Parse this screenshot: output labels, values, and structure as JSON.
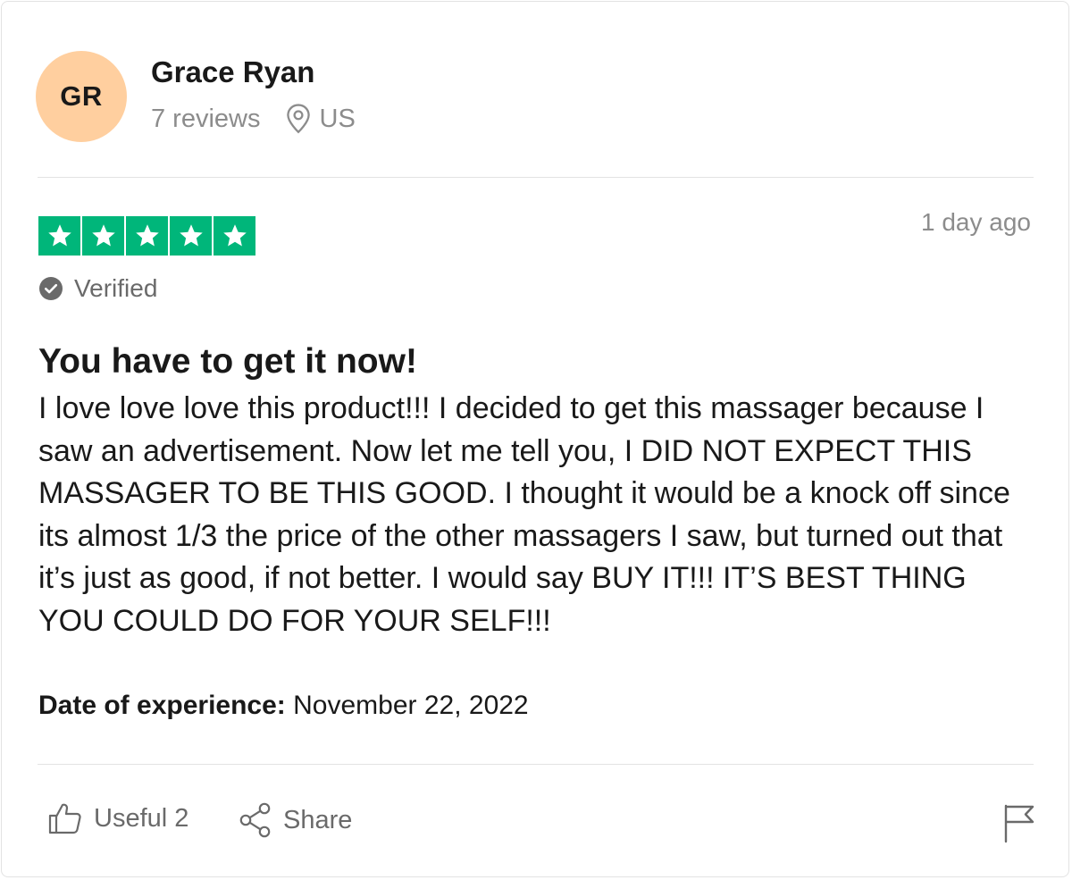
{
  "reviewer": {
    "initials": "GR",
    "name": "Grace Ryan",
    "reviews_count": "7 reviews",
    "country": "US",
    "avatar_color": "#ffcf9f"
  },
  "review": {
    "rating": 5,
    "rating_max": 5,
    "star_color": "#00b67a",
    "date": "1 day ago",
    "verified_label": "Verified",
    "title": "You have to get it now!",
    "body": "I love love love this product!!! I decided to get this massager because I saw an advertisement. Now let me tell you, I DID NOT EXPECT THIS MASSAGER TO BE THIS GOOD. I thought it would be a knock off since its almost 1/3 the price of the other massagers I saw, but turned out that it’s just as good, if not better. I would say BUY IT!!! IT’S BEST THING YOU COULD DO FOR YOUR SELF!!!",
    "experience_label": "Date of experience:",
    "experience_date": "November 22, 2022"
  },
  "actions": {
    "useful_label": "Useful 2",
    "share_label": "Share"
  },
  "icons": {
    "location": "location-pin-icon",
    "verified": "check-circle-icon",
    "useful": "thumbs-up-icon",
    "share": "share-icon",
    "report": "flag-icon",
    "star": "star-icon"
  }
}
